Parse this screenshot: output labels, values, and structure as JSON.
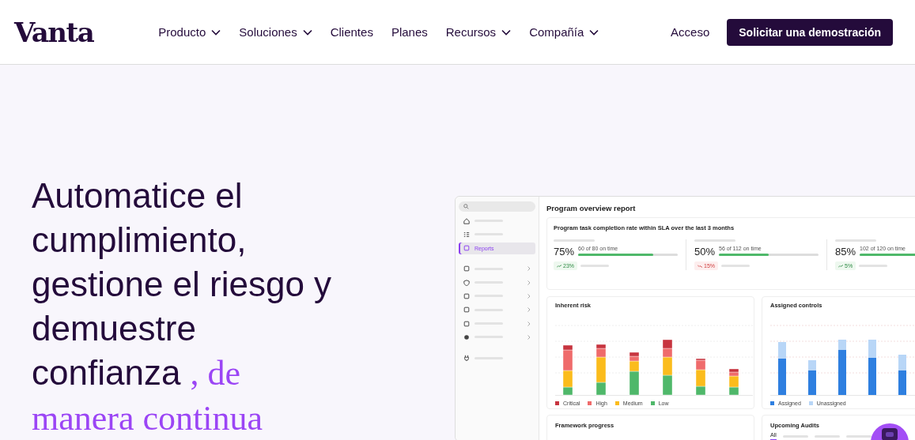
{
  "header": {
    "logo": "Vanta",
    "nav": [
      {
        "label": "Producto",
        "dropdown": true
      },
      {
        "label": "Soluciones",
        "dropdown": true
      },
      {
        "label": "Clientes",
        "dropdown": false
      },
      {
        "label": "Planes",
        "dropdown": false
      },
      {
        "label": "Recursos",
        "dropdown": true
      },
      {
        "label": "Compañía",
        "dropdown": true
      }
    ],
    "login": "Acceso",
    "cta": "Solicitar una demostración"
  },
  "hero": {
    "headline": "Automatice el cumplimiento, gestione el riesgo y demuestre confianza",
    "highlight": ", de manera continua"
  },
  "dashboard": {
    "sidebar": [
      {
        "selected": false,
        "expandable": false
      },
      {
        "selected": false,
        "expandable": false
      },
      {
        "label": "Reports",
        "selected": true,
        "expandable": false
      },
      {
        "selected": false,
        "expandable": true
      },
      {
        "selected": false,
        "expandable": true
      },
      {
        "selected": false,
        "expandable": true
      },
      {
        "selected": false,
        "expandable": true
      },
      {
        "selected": false,
        "expandable": true
      },
      {
        "selected": false,
        "expandable": true
      },
      {
        "selected": false,
        "expandable": false
      }
    ],
    "title": "Program overview report",
    "completion": {
      "title": "Program task completion rate within SLA over the last 3 months",
      "metrics": [
        {
          "value": "75%",
          "caption": "60 of 80 on time",
          "level": 0.75,
          "change": "23%",
          "kind": "up"
        },
        {
          "value": "50%",
          "caption": "56 of 112 on time",
          "level": 0.5,
          "change": "15%",
          "kind": "down"
        },
        {
          "value": "85%",
          "caption": "102 of 120 on time",
          "level": 0.85,
          "change": "5%",
          "kind": "up"
        }
      ]
    },
    "risk": {
      "title": "Inherent risk",
      "legend": [
        {
          "label": "Critical",
          "color": "#c7343f"
        },
        {
          "label": "High",
          "color": "#ef6b6b"
        },
        {
          "label": "Medium",
          "color": "#fbbc1c"
        },
        {
          "label": "Low",
          "color": "#4fb86a"
        }
      ]
    },
    "controls": {
      "title": "Assigned controls",
      "legend": [
        {
          "label": "Assigned",
          "color": "#2e7fe0"
        },
        {
          "label": "Unassigned",
          "color": "#b8d6f7"
        }
      ]
    },
    "framework": {
      "title": "Framework progress"
    },
    "audits": {
      "title": "Upcoming Audits",
      "tabs": [
        {
          "label": "All",
          "selected": true
        }
      ]
    }
  }
}
